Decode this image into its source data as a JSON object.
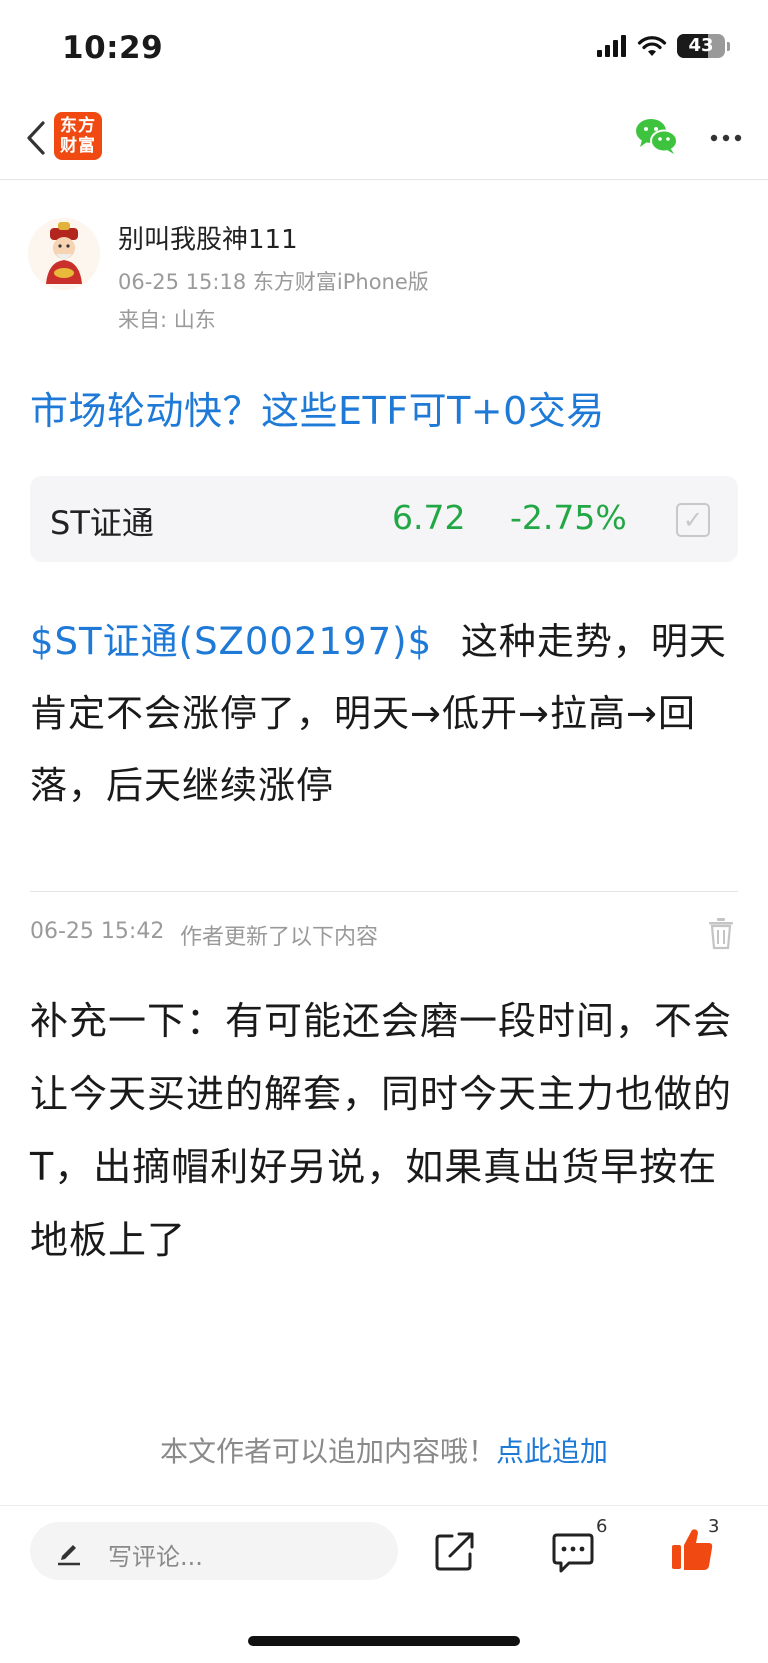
{
  "status_bar": {
    "time": "10:29",
    "battery": "43"
  },
  "nav": {
    "logo_line1": "东方",
    "logo_line2": "财富",
    "brand_color": "#f04a12"
  },
  "post": {
    "author": "别叫我股神111",
    "meta": "06-25 15:18 东方财富iPhone版",
    "from": "来自: 山东",
    "title": "市场轮动快？这些ETF可T+0交易",
    "stock_card": {
      "name": "ST证通",
      "price": "6.72",
      "change": "-2.75%",
      "change_color": "#22a745"
    },
    "body_link": "$ST证通(SZ002197)$",
    "body_text": "这种走势，明天肯定不会涨停了，明天→低开→拉高→回落，后天继续涨停",
    "update_time": "06-25 15:42",
    "update_note": "作者更新了以下内容",
    "update_text": "补充一下：有可能还会磨一段时间，不会让今天买进的解套，同时今天主力也做的T，出摘帽利好另说，如果真出货早按在地板上了"
  },
  "append": {
    "hint": "本文作者可以追加内容哦！",
    "link": "点此追加"
  },
  "bottom_bar": {
    "comment_placeholder": "写评论...",
    "comments_count": "6",
    "likes_count": "3",
    "accent_color": "#1e7ad6",
    "like_color": "#f04a12"
  }
}
